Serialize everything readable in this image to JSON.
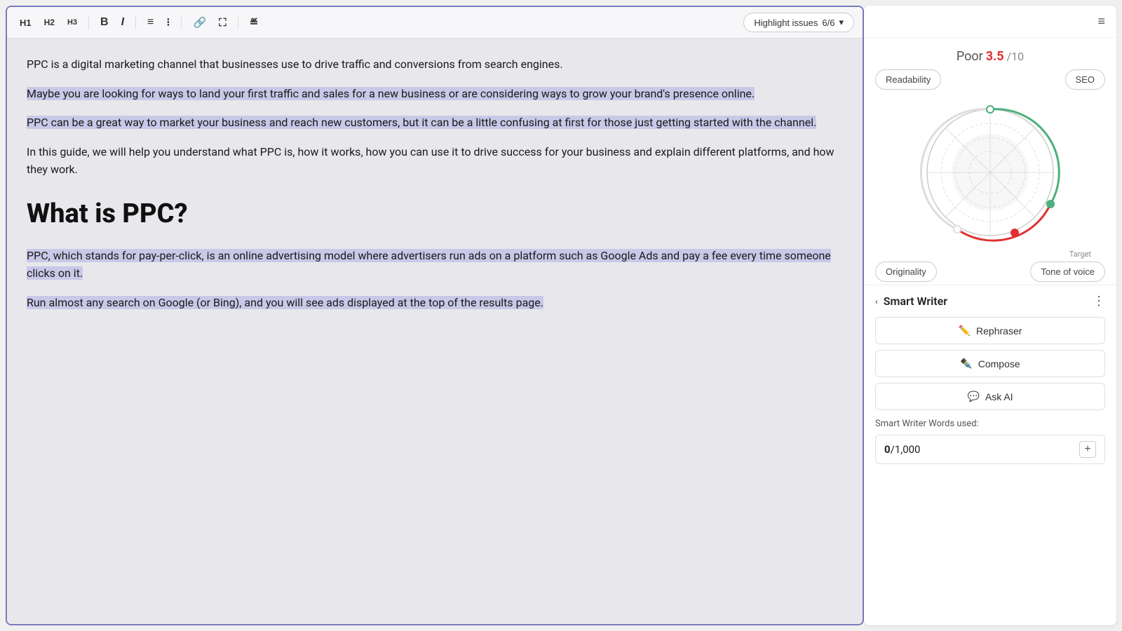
{
  "toolbar": {
    "h1_label": "H1",
    "h2_label": "H2",
    "h3_label": "H3",
    "bold_label": "B",
    "italic_label": "I",
    "highlight_issues_label": "Highlight issues",
    "highlight_count": "6/6"
  },
  "editor": {
    "paragraph1": "PPC is a digital marketing channel that businesses use to drive traffic and conversions from search engines.",
    "paragraph2": "Maybe you are looking for ways to land your first traffic and sales for a new business or are considering ways to grow your brand's presence online.",
    "paragraph3": "PPC can be a great way to market your business and reach new customers, but it can be a little confusing at first for those just getting started with the channel.",
    "paragraph4": "In this guide, we will help you understand what PPC is, how it works, how you can use it to drive success for your business and explain different platforms, and how they work.",
    "heading": "What is PPC?",
    "paragraph5": "PPC, which stands for pay-per-click, is an online advertising model where advertisers run ads on a platform such as Google Ads and pay a fee every time someone clicks on it.",
    "paragraph6": "Run almost any search on Google (or Bing), and you will see ads displayed at the top of the results page."
  },
  "sidebar": {
    "score_label": "Poor",
    "score_value": "3.5",
    "score_suffix": "/10",
    "readability_label": "Readability",
    "seo_label": "SEO",
    "originality_label": "Originality",
    "tone_of_voice_label": "Tone of voice",
    "target_label": "Target",
    "smart_writer": {
      "title": "Smart Writer",
      "rephraser_label": "Rephraser",
      "compose_label": "Compose",
      "ask_ai_label": "Ask AI",
      "words_used_label": "Smart Writer Words used:",
      "words_count": "0",
      "words_total": "1,000"
    }
  },
  "icons": {
    "menu": "≡",
    "chevron_down": "▾",
    "collapse": "‹",
    "more": "⋮",
    "rephraser": "✏",
    "compose": "✒",
    "ask_ai": "💬",
    "add": "+"
  }
}
